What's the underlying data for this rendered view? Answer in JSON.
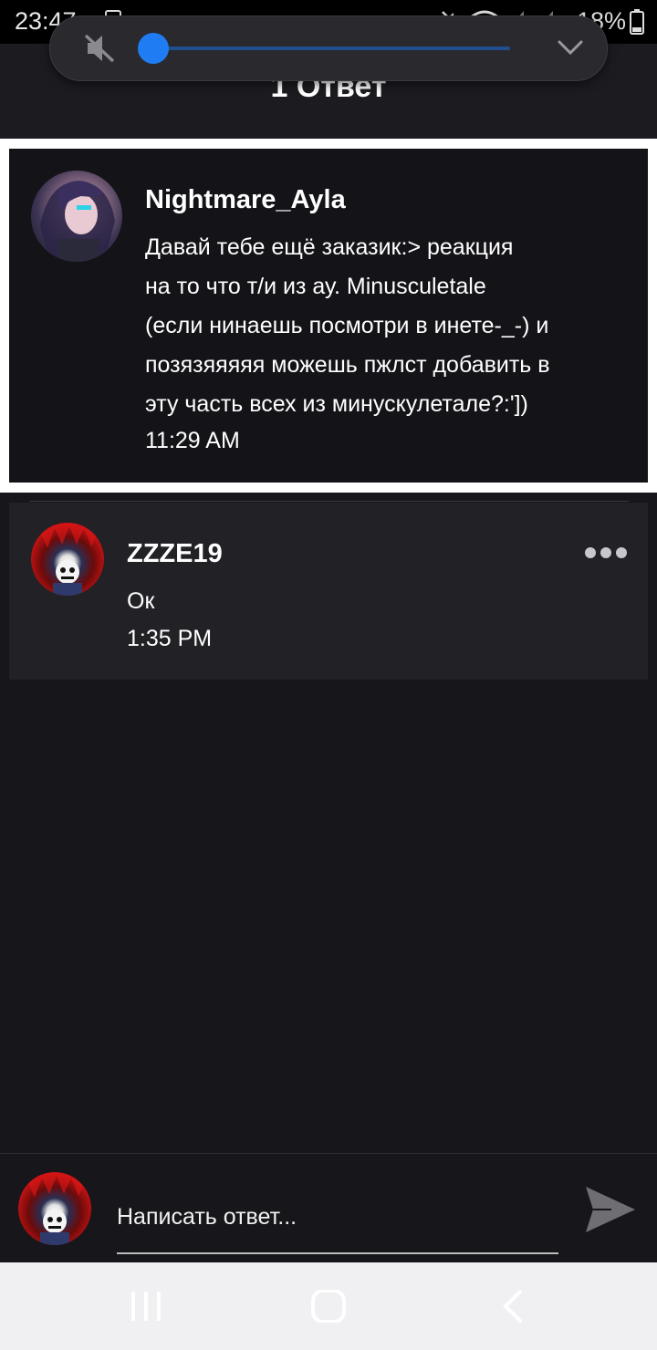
{
  "status_bar": {
    "time": "23:47",
    "battery": "18%",
    "icons": [
      "screenshot-icon",
      "mute-status-icon",
      "wifi-icon",
      "signal-icon",
      "signal-icon-2",
      "battery-icon"
    ]
  },
  "volume_panel": {
    "level": 0.0,
    "icons": [
      "mute-icon",
      "chevron-down-icon"
    ]
  },
  "header": {
    "title": "1 Ответ"
  },
  "parent_comment": {
    "author": "Nightmare_Ayla",
    "body": "Давай тебе ещё заказик:> реакция\nна то что т/и из ау. Minusculetale\n(если нинаешь посмотри в инете-_-) и\nпозязяяяяя можешь пжлст добавить в\nэту часть всех из минускулетале?:']) ",
    "time": "11:29 AM"
  },
  "reply": {
    "author": "ZZZE19",
    "body": "Ок",
    "time": "1:35 PM",
    "menu_icon": "more-dots-icon"
  },
  "composer": {
    "placeholder": "Написать ответ...",
    "send_icon": "send-icon"
  },
  "nav_bar": {
    "icons": [
      "recent-apps-icon",
      "home-icon",
      "back-icon"
    ]
  },
  "colors": {
    "background": "#17161b",
    "accent": "#1f7cf2",
    "reply_card": "#222126"
  }
}
